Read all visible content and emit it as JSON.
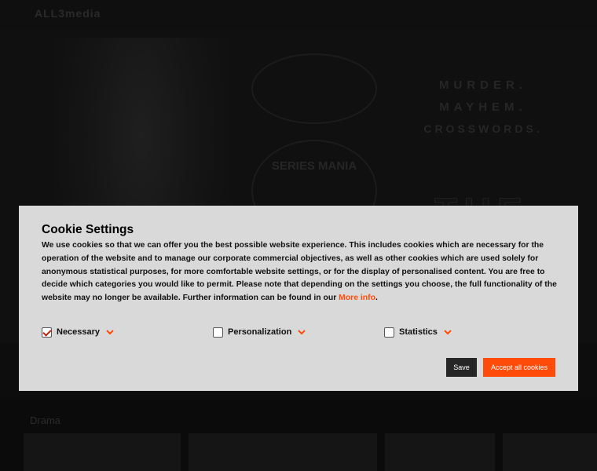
{
  "background": {
    "logo": "ALL3media",
    "nav_items": [
      "",
      "",
      "",
      ""
    ],
    "hero_award_top": "",
    "hero_award_bottom": "SERIES MANIA",
    "hero_tagline": [
      "MURDER.",
      "MAYHEM.",
      "CROSSWORDS."
    ],
    "hero_title": "THE",
    "section_label": "Drama"
  },
  "cookie_dialog": {
    "title": "Cookie Settings",
    "body": "We use cookies so that we can offer you the best possible website experience. This includes cookies which are necessary for the operation of the website and to manage our corporate commercial objectives, as well as other cookies which are used solely for anonymous statistical purposes, for more comfortable website settings, or for the display of personalised content. You are free to decide which categories you would like to permit. Please note that depending on the settings you choose, the full functionality of the website may no longer be available. Further information can be found in our ",
    "more_info_link": "More info",
    "body_end": ".",
    "options": [
      {
        "label": "Necessary",
        "checked": true
      },
      {
        "label": "Personalization",
        "checked": false
      },
      {
        "label": "Statistics",
        "checked": false
      }
    ],
    "save_label": "Save",
    "accept_label": "Accept all cookies",
    "accent_color": "#ff4b0a",
    "icons": {
      "chevron": "chevron-down-icon"
    }
  }
}
